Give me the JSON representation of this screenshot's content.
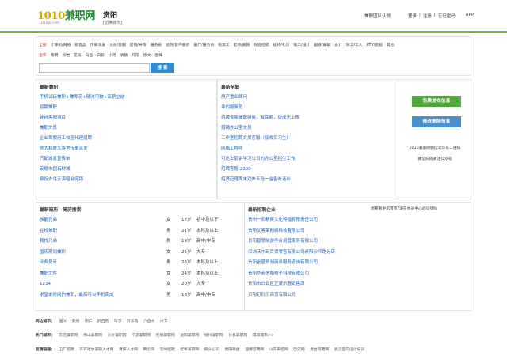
{
  "header": {
    "logo_num": "1010",
    "logo_text": "兼职网",
    "logo_sub": "1010jz.com",
    "city": "贵阳",
    "city_switch": "[切换城市]",
    "nav": [
      "兼职团队认领",
      "登录",
      "注册",
      "忘记密码",
      "APP"
    ],
    "nav_sep": "|"
  },
  "filter": {
    "row1": [
      "全部",
      "计算机/网络",
      "销售类",
      "传单派发",
      "文员/客服",
      "促销/导购",
      "服务员",
      "话务/客户服务",
      "餐厅/服务员",
      "物流工",
      "老师/家教",
      "校园招聘",
      "模特/礼仪",
      "美工/设计",
      "翻译/编辑",
      "会计",
      "日工/工人",
      "KTV/营销",
      "其他"
    ],
    "row2": [
      "全市",
      "南明",
      "云岩",
      "花溪",
      "乌当",
      "白云",
      "小河",
      "清镇",
      "开阳",
      "修文",
      "息烽"
    ],
    "search_placeholder": "",
    "search_button": "搜 索"
  },
  "latest_jobs": {
    "title": "最新兼职",
    "items": [
      "手机试玩兼职+赚零花+随时可做+高薪立结",
      "招聘兼职",
      "钟标客服项目",
      "兼职文员",
      "企业寒假用工校园代理招聘",
      "师大和财大寒舍传单派发",
      "汽配城发宣传单",
      "安顺市国石材城",
      "泉捉去月天演唱会促销"
    ]
  },
  "latest_posts": {
    "title": "最新全职",
    "items": [
      "房产置业顾问",
      "寻的服务员",
      "招聘专家兼职骑侠，有底薪，提成无上限",
      "招聘办公室文员",
      "工作室招聘文员客服（接收实习生）",
      "网络工程师",
      "可达上层讲学习公司的办公室招生工作",
      "招聘客服 2200",
      "招贤赶理周末双休五险一金备补话补"
    ]
  },
  "sidebar": {
    "post_free": "免费发布信息",
    "edit_info": "修改删除信息",
    "qr_caption": "1010兼职网微信公众号二维码",
    "qr_caption2": "微信扫码关注公众号"
  },
  "resumes": {
    "title": "最新简历",
    "subtitle": "简历搜索",
    "rows": [
      {
        "name": "族能兄弟",
        "sex": "女",
        "age": "17岁",
        "edu": "初中及以下"
      },
      {
        "name": "在校兼职",
        "sex": "男",
        "age": "21岁",
        "edu": "本科及以上"
      },
      {
        "name": "我找兄弟",
        "sex": "男",
        "age": "19岁",
        "edu": "高中/中专"
      },
      {
        "name": "国庆期间兼职",
        "sex": "女",
        "age": "25岁",
        "edu": "大专"
      },
      {
        "name": "业务员来",
        "sex": "男",
        "age": "26岁",
        "edu": "本科及以上"
      },
      {
        "name": "兼职文件",
        "sex": "女",
        "age": "24岁",
        "edu": "本科及以上"
      },
      {
        "name": "1234",
        "sex": "女",
        "age": "20岁",
        "edu": "大专"
      },
      {
        "name": "求望求时间的兼职，最后可以手机完成",
        "sex": "男",
        "age": "18岁",
        "edu": "高中/中专"
      }
    ]
  },
  "companies": {
    "title": "最新招聘企业",
    "note": "想要看手机首页?请在会员中心验证登陆",
    "items": [
      "贵州一石精英文化传播有限责任公司",
      "贵阳优客莱网络科技有限公司",
      "贵阳智慧晓游手合运营服务有限公司",
      "深圳沃尔玛百货零售有限公司贵阳沙坪路分店",
      "贵阳金盛贸湖商务服务咨询有限公司",
      "贵阳华商信和电子科技有限公司",
      "贵阳市白云区正茂乐器销售店",
      "贵阳钉钉乐商贸有限公司"
    ]
  },
  "footer": {
    "nearby_label": "周边城市：",
    "nearby": [
      "遵义",
      "安顺",
      "铜仁",
      "黔西南",
      "毕节",
      "黔东南",
      "六盘水",
      "兴节"
    ],
    "popular_label": "热门城市：",
    "popular": [
      "东莞兼职网",
      "佛山兼职网",
      "长沙兼职网",
      "宁波兼职网",
      "无锡兼职网",
      "沈阳兼职网",
      "福州兼职网",
      "长春兼职网",
      "得阳城市>>"
    ],
    "friends_label": "友情链接：",
    "friends": [
      "卫厂招聘",
      "齐齐哈尔兼职人才网",
      "贵阳人才网",
      "腾云网",
      "常州招聘",
      "蚌埠兼职网",
      "蕉头公司",
      "贵阳商盘",
      "淄博招聘网",
      "山东来招网",
      "历史网",
      "贵台招聘网",
      "武汉室内设计培训"
    ]
  }
}
